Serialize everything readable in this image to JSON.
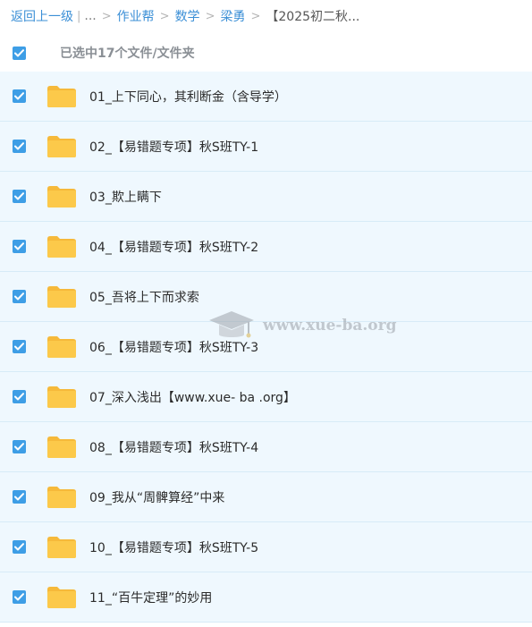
{
  "breadcrumb": {
    "back_label": "返回上一级",
    "divider": "|",
    "ellipsis": "...",
    "items": [
      {
        "label": "作业帮"
      },
      {
        "label": "数学"
      },
      {
        "label": "梁勇"
      }
    ],
    "current": "【2025初二秋...",
    "separator": ">"
  },
  "selection": {
    "summary": "已选中17个文件/文件夹",
    "all_checked": true
  },
  "files": [
    {
      "name": "01_上下同心，其利断金（含导学）",
      "checked": true,
      "icon": "folder-icon"
    },
    {
      "name": "02_【易错题专项】秋S班TY-1",
      "checked": true,
      "icon": "folder-icon"
    },
    {
      "name": "03_欺上瞒下",
      "checked": true,
      "icon": "folder-icon"
    },
    {
      "name": "04_【易错题专项】秋S班TY-2",
      "checked": true,
      "icon": "folder-icon"
    },
    {
      "name": "05_吾将上下而求索",
      "checked": true,
      "icon": "folder-icon"
    },
    {
      "name": "06_【易错题专项】秋S班TY-3",
      "checked": true,
      "icon": "folder-icon"
    },
    {
      "name": "07_深入浅出【www.xue- ba .org】",
      "checked": true,
      "icon": "folder-icon"
    },
    {
      "name": "08_【易错题专项】秋S班TY-4",
      "checked": true,
      "icon": "folder-icon"
    },
    {
      "name": "09_我从“周髀算经”中来",
      "checked": true,
      "icon": "folder-icon"
    },
    {
      "name": "10_【易错题专项】秋S班TY-5",
      "checked": true,
      "icon": "folder-icon"
    },
    {
      "name": "11_“百牛定理”的妙用",
      "checked": true,
      "icon": "folder-icon"
    }
  ],
  "watermark": {
    "text": "www.xue-ba.org",
    "icon": "graduation-cap-icon"
  },
  "colors": {
    "accent": "#3e9ee6",
    "link": "#3b8fd6",
    "row_background": "#eff8fe",
    "folder": "#fcc94a"
  }
}
